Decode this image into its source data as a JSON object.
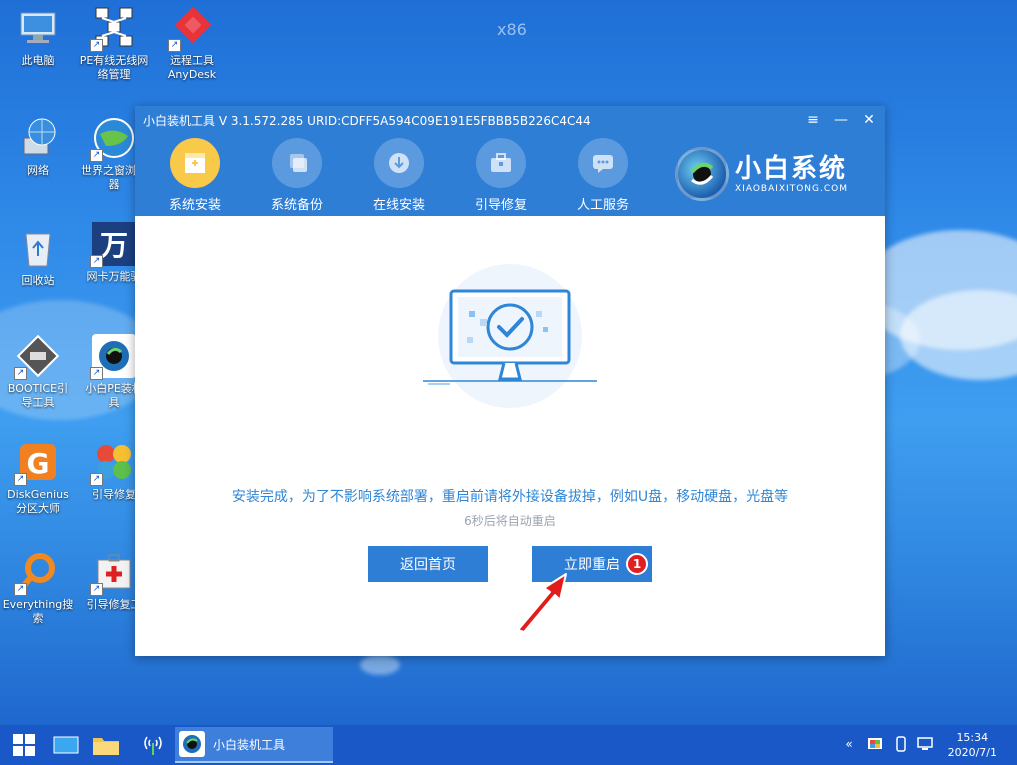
{
  "desktop": {
    "watermark": "x86",
    "icons": [
      {
        "label": "此电脑"
      },
      {
        "label": "PE有线无线网\n络管理"
      },
      {
        "label": "远程工具\nAnyDesk"
      },
      {
        "label": "网络"
      },
      {
        "label": "世界之窗浏览\n器"
      },
      {
        "label": "回收站"
      },
      {
        "label": "网卡万能驱"
      },
      {
        "label": "BOOTICE引\n导工具"
      },
      {
        "label": "小白PE装机\n具"
      },
      {
        "label": "DiskGenius\n分区大师"
      },
      {
        "label": "引导修复"
      },
      {
        "label": "Everything搜\n索"
      },
      {
        "label": "引导修复工"
      }
    ]
  },
  "window": {
    "title": "小白装机工具 V 3.1.572.285 URID:CDFF5A594C09E191E5FBBB5B226C4C44",
    "controls": {
      "menu": "≡",
      "minimize": "—",
      "close": "✕"
    },
    "nav": [
      {
        "label": "系统安装",
        "icon": "windows-box-icon",
        "active": true
      },
      {
        "label": "系统备份",
        "icon": "backup-icon",
        "active": false
      },
      {
        "label": "在线安装",
        "icon": "download-icon",
        "active": false
      },
      {
        "label": "引导修复",
        "icon": "toolbox-icon",
        "active": false
      },
      {
        "label": "人工服务",
        "icon": "chat-icon",
        "active": false
      }
    ],
    "brand": {
      "name": "小白系统",
      "sub": "XIAOBAIXITONG.COM"
    },
    "message": "安装完成，为了不影响系统部署，重启前请将外接设备拔掉，例如U盘，移动硬盘，光盘等",
    "countdown": "6秒后将自动重启",
    "buttons": {
      "back": "返回首页",
      "restart": "立即重启"
    },
    "badge": "1"
  },
  "taskbar": {
    "app_label": "小白装机工具",
    "time": "15:34",
    "date": "2020/7/1",
    "tray_chevron": "«"
  },
  "colors": {
    "accent": "#2f7ed6",
    "message": "#2f86d6",
    "active_nav": "#f9c94a",
    "badge": "#e02020",
    "taskbar": "#1b58c7"
  }
}
